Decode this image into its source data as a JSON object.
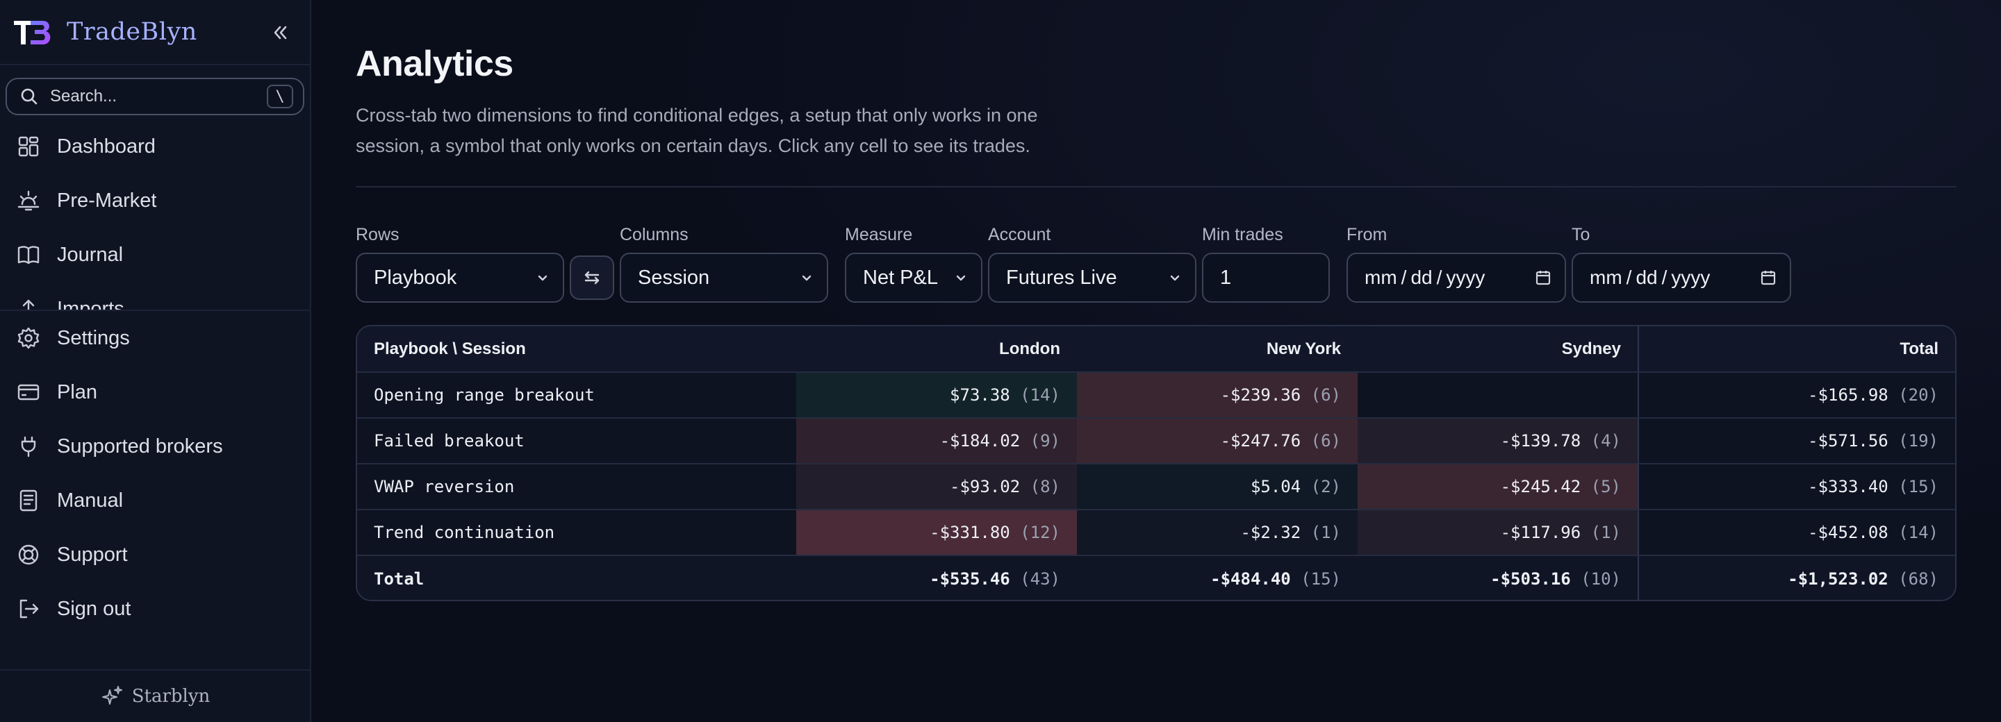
{
  "sidebar": {
    "brand": "TradeBlyn",
    "search_placeholder": "Search...",
    "search_shortcut": "\\",
    "nav_top": [
      {
        "label": "Dashboard",
        "icon": "dashboard-icon"
      },
      {
        "label": "Pre-Market",
        "icon": "sunrise-icon"
      },
      {
        "label": "Journal",
        "icon": "book-icon"
      },
      {
        "label": "Imports",
        "icon": "upload-icon"
      }
    ],
    "nav_bottom": [
      {
        "label": "Settings",
        "icon": "gear-icon"
      },
      {
        "label": "Plan",
        "icon": "credit-card-icon"
      },
      {
        "label": "Supported brokers",
        "icon": "plug-icon"
      },
      {
        "label": "Manual",
        "icon": "document-icon"
      },
      {
        "label": "Support",
        "icon": "lifebuoy-icon"
      },
      {
        "label": "Sign out",
        "icon": "sign-out-icon"
      }
    ],
    "footer": "Starblyn"
  },
  "page": {
    "title": "Analytics",
    "description": "Cross-tab two dimensions to find conditional edges, a setup that only works in one session, a symbol that only works on certain days. Click any cell to see its trades."
  },
  "controls": {
    "rows": {
      "label": "Rows",
      "value": "Playbook"
    },
    "columns": {
      "label": "Columns",
      "value": "Session"
    },
    "measure": {
      "label": "Measure",
      "value": "Net P&L"
    },
    "account": {
      "label": "Account",
      "value": "Futures Live"
    },
    "min_trades": {
      "label": "Min trades",
      "value": "1"
    },
    "from": {
      "label": "From",
      "mm": "mm",
      "dd": "dd",
      "yyyy": "yyyy"
    },
    "to": {
      "label": "To",
      "mm": "mm",
      "dd": "dd",
      "yyyy": "yyyy"
    }
  },
  "table": {
    "corner": "Playbook \\ Session",
    "columns": [
      "London",
      "New York",
      "Sydney"
    ],
    "total_label": "Total",
    "rows": [
      {
        "name": "Opening range breakout",
        "cells": [
          {
            "v": "$73.38",
            "n": "(14)",
            "tone": "pos1"
          },
          {
            "v": "-$239.36",
            "n": "(6)",
            "tone": "neg3"
          },
          {
            "v": "",
            "n": "",
            "tone": "none"
          }
        ],
        "total": {
          "v": "-$165.98",
          "n": "(20)"
        }
      },
      {
        "name": "Failed breakout",
        "cells": [
          {
            "v": "-$184.02",
            "n": "(9)",
            "tone": "neg2"
          },
          {
            "v": "-$247.76",
            "n": "(6)",
            "tone": "neg3"
          },
          {
            "v": "-$139.78",
            "n": "(4)",
            "tone": "neg1"
          }
        ],
        "total": {
          "v": "-$571.56",
          "n": "(19)"
        }
      },
      {
        "name": "VWAP reversion",
        "cells": [
          {
            "v": "-$93.02",
            "n": "(8)",
            "tone": "neg1"
          },
          {
            "v": "$5.04",
            "n": "(2)",
            "tone": "pos0"
          },
          {
            "v": "-$245.42",
            "n": "(5)",
            "tone": "neg3"
          }
        ],
        "total": {
          "v": "-$333.40",
          "n": "(15)"
        }
      },
      {
        "name": "Trend continuation",
        "cells": [
          {
            "v": "-$331.80",
            "n": "(12)",
            "tone": "neg4"
          },
          {
            "v": "-$2.32",
            "n": "(1)",
            "tone": "neg0"
          },
          {
            "v": "-$117.96",
            "n": "(1)",
            "tone": "neg1"
          }
        ],
        "total": {
          "v": "-$452.08",
          "n": "(14)"
        }
      }
    ],
    "totals": {
      "cells": [
        {
          "v": "-$535.46",
          "n": "(43)"
        },
        {
          "v": "-$484.40",
          "n": "(15)"
        },
        {
          "v": "-$503.16",
          "n": "(10)"
        }
      ],
      "grand": {
        "v": "-$1,523.02",
        "n": "(68)"
      }
    },
    "tone_colors": {
      "pos1": "#13232a",
      "pos0": "#0f1a26",
      "none": "#0e1322",
      "neg0": "#121726",
      "neg1": "#231e2c",
      "neg2": "#2f222e",
      "neg3": "#3a2631",
      "neg4": "#4a2b37"
    }
  }
}
